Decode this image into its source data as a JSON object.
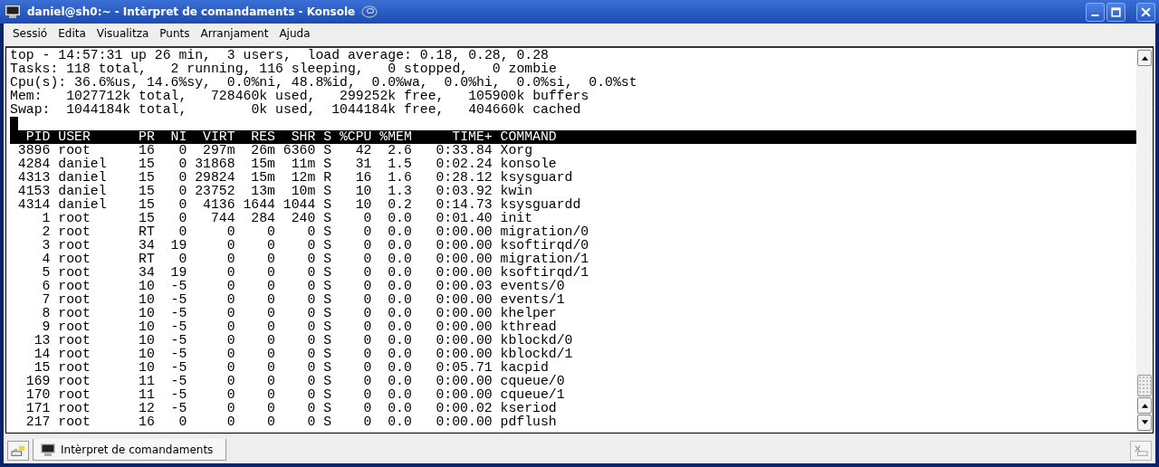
{
  "window": {
    "title": "daniel@sh0:~ - Intèrpret de comandaments - Konsole"
  },
  "menu": [
    "Sessió",
    "Edita",
    "Visualitza",
    "Punts",
    "Arranjament",
    "Ajuda"
  ],
  "summary_lines": [
    "top - 14:57:31 up 26 min,  3 users,  load average: 0.18, 0.28, 0.28",
    "Tasks: 118 total,   2 running, 116 sleeping,   0 stopped,   0 zombie",
    "Cpu(s): 36.6%us, 14.6%sy,  0.0%ni, 48.8%id,  0.0%wa,  0.0%hi,  0.0%si,  0.0%st",
    "Mem:   1027712k total,   728460k used,   299252k free,   105900k buffers",
    "Swap:  1044184k total,        0k used,  1044184k free,   404660k cached"
  ],
  "table": {
    "columns": [
      "PID",
      "USER",
      "PR",
      "NI",
      "VIRT",
      "RES",
      "SHR",
      "S",
      "%CPU",
      "%MEM",
      "TIME+",
      "COMMAND"
    ],
    "rows": [
      [
        "3896",
        "root",
        "16",
        "0",
        "297m",
        "26m",
        "6360",
        "S",
        "42",
        "2.6",
        "0:33.84",
        "Xorg"
      ],
      [
        "4284",
        "daniel",
        "15",
        "0",
        "31868",
        "15m",
        "11m",
        "S",
        "31",
        "1.5",
        "0:02.24",
        "konsole"
      ],
      [
        "4313",
        "daniel",
        "15",
        "0",
        "29824",
        "15m",
        "12m",
        "R",
        "16",
        "1.6",
        "0:28.12",
        "ksysguard"
      ],
      [
        "4153",
        "daniel",
        "15",
        "0",
        "23752",
        "13m",
        "10m",
        "S",
        "10",
        "1.3",
        "0:03.92",
        "kwin"
      ],
      [
        "4314",
        "daniel",
        "15",
        "0",
        "4136",
        "1644",
        "1044",
        "S",
        "10",
        "0.2",
        "0:14.73",
        "ksysguardd"
      ],
      [
        "1",
        "root",
        "15",
        "0",
        "744",
        "284",
        "240",
        "S",
        "0",
        "0.0",
        "0:01.40",
        "init"
      ],
      [
        "2",
        "root",
        "RT",
        "0",
        "0",
        "0",
        "0",
        "S",
        "0",
        "0.0",
        "0:00.00",
        "migration/0"
      ],
      [
        "3",
        "root",
        "34",
        "19",
        "0",
        "0",
        "0",
        "S",
        "0",
        "0.0",
        "0:00.00",
        "ksoftirqd/0"
      ],
      [
        "4",
        "root",
        "RT",
        "0",
        "0",
        "0",
        "0",
        "S",
        "0",
        "0.0",
        "0:00.00",
        "migration/1"
      ],
      [
        "5",
        "root",
        "34",
        "19",
        "0",
        "0",
        "0",
        "S",
        "0",
        "0.0",
        "0:00.00",
        "ksoftirqd/1"
      ],
      [
        "6",
        "root",
        "10",
        "-5",
        "0",
        "0",
        "0",
        "S",
        "0",
        "0.0",
        "0:00.03",
        "events/0"
      ],
      [
        "7",
        "root",
        "10",
        "-5",
        "0",
        "0",
        "0",
        "S",
        "0",
        "0.0",
        "0:00.00",
        "events/1"
      ],
      [
        "8",
        "root",
        "10",
        "-5",
        "0",
        "0",
        "0",
        "S",
        "0",
        "0.0",
        "0:00.00",
        "khelper"
      ],
      [
        "9",
        "root",
        "10",
        "-5",
        "0",
        "0",
        "0",
        "S",
        "0",
        "0.0",
        "0:00.00",
        "kthread"
      ],
      [
        "13",
        "root",
        "10",
        "-5",
        "0",
        "0",
        "0",
        "S",
        "0",
        "0.0",
        "0:00.00",
        "kblockd/0"
      ],
      [
        "14",
        "root",
        "10",
        "-5",
        "0",
        "0",
        "0",
        "S",
        "0",
        "0.0",
        "0:00.00",
        "kblockd/1"
      ],
      [
        "15",
        "root",
        "10",
        "-5",
        "0",
        "0",
        "0",
        "S",
        "0",
        "0.0",
        "0:05.71",
        "kacpid"
      ],
      [
        "169",
        "root",
        "11",
        "-5",
        "0",
        "0",
        "0",
        "S",
        "0",
        "0.0",
        "0:00.00",
        "cqueue/0"
      ],
      [
        "170",
        "root",
        "11",
        "-5",
        "0",
        "0",
        "0",
        "S",
        "0",
        "0.0",
        "0:00.00",
        "cqueue/1"
      ],
      [
        "171",
        "root",
        "12",
        "-5",
        "0",
        "0",
        "0",
        "S",
        "0",
        "0.0",
        "0:00.02",
        "kseriod"
      ],
      [
        "217",
        "root",
        "16",
        "0",
        "0",
        "0",
        "0",
        "S",
        "0",
        "0.0",
        "0:00.00",
        "pdflush"
      ]
    ]
  },
  "tabs": [
    {
      "label": "Intèrpret de comandaments",
      "selected": true
    }
  ]
}
